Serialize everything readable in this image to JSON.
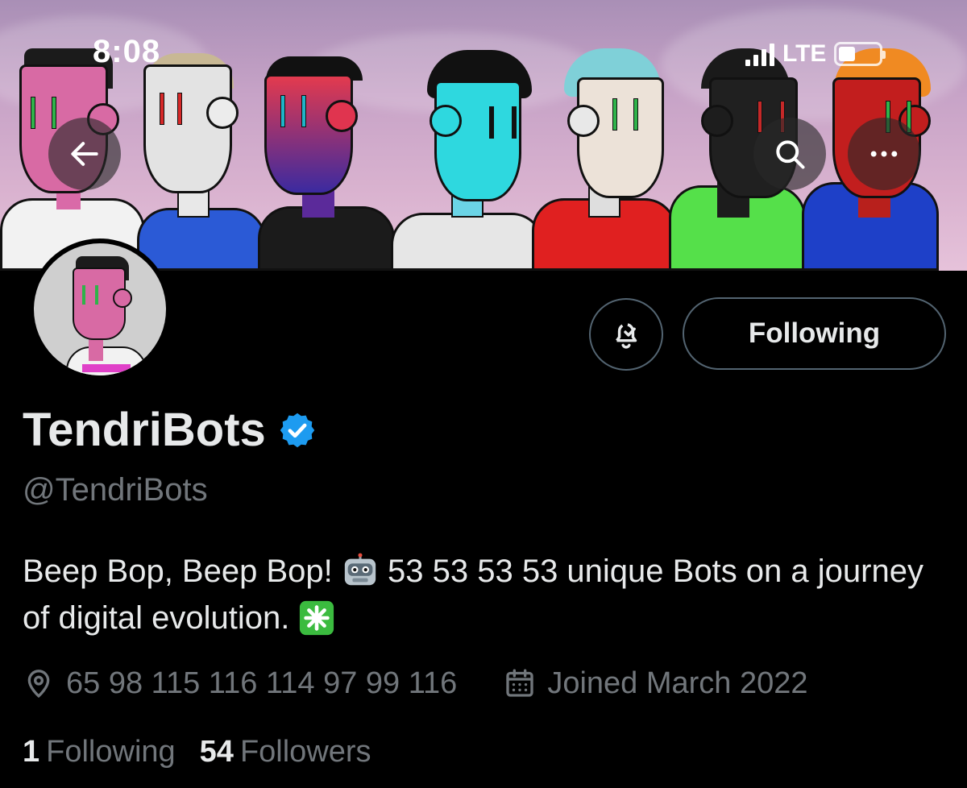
{
  "status_bar": {
    "time": "8:08",
    "network": "LTE"
  },
  "header": {
    "back_icon": "arrow-left-icon",
    "search_icon": "search-icon",
    "more_icon": "more-horizontal-icon"
  },
  "actions": {
    "notify_icon": "bell-check-icon",
    "following_label": "Following"
  },
  "profile": {
    "display_name": "TendriBots",
    "verified_icon": "verified-badge-icon",
    "handle": "@TendriBots",
    "bio_part1": "Beep Bop, Beep Bop!",
    "bio_emoji1": "robot-emoji",
    "bio_part2": " 53 53 53 53 unique Bots on a journey of digital evolution.",
    "bio_emoji2": "eight-spoked-asterisk-emoji",
    "location": "65 98 115 116 114 97 99 116",
    "joined": "Joined March 2022"
  },
  "stats": {
    "following_count": "1",
    "following_label": "Following",
    "followers_count": "54",
    "followers_label": "Followers"
  },
  "colors": {
    "accent": "#1d9bf0",
    "secondary_text": "#71767b",
    "border": "#536471"
  }
}
